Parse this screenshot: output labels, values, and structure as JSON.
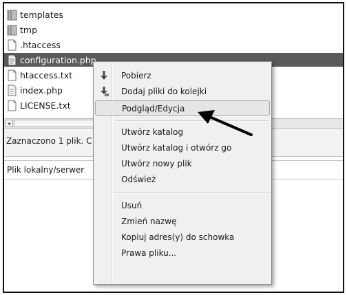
{
  "files": [
    {
      "name": "templates",
      "icon": "folder-icon"
    },
    {
      "name": "tmp",
      "icon": "folder-icon"
    },
    {
      "name": ".htaccess",
      "icon": "file-icon"
    },
    {
      "name": "configuration.php",
      "icon": "php-file-icon",
      "selected": true
    },
    {
      "name": "htaccess.txt",
      "icon": "file-icon"
    },
    {
      "name": "index.php",
      "icon": "php-file-icon"
    },
    {
      "name": "LICENSE.txt",
      "icon": "file-icon"
    }
  ],
  "status": {
    "text": "Zaznaczono 1 plik. C"
  },
  "queue": {
    "column_local": "Plik lokalny/serwer"
  },
  "scroll_left_glyph": "◂",
  "context_menu": {
    "items": [
      {
        "label": "Pobierz",
        "icon": "download-arrow-icon"
      },
      {
        "label": "Dodaj pliki do kolejki",
        "icon": "add-to-queue-icon"
      },
      {
        "label": "Podgląd/Edycja",
        "highlighted": true
      },
      {
        "label": "Utwórz katalog"
      },
      {
        "label": "Utwórz katalog i otwórz go"
      },
      {
        "label": "Utwórz nowy plik"
      },
      {
        "label": "Odśwież"
      },
      {
        "label": "Usuń"
      },
      {
        "label": "Zmień nazwę"
      },
      {
        "label": "Kopiuj adres(y) do schowka"
      },
      {
        "label": "Prawa pliku..."
      }
    ]
  },
  "colors": {
    "selection": "#5a5a5a",
    "menu_bg": "#f0f0f0",
    "arrow": "#000000"
  }
}
